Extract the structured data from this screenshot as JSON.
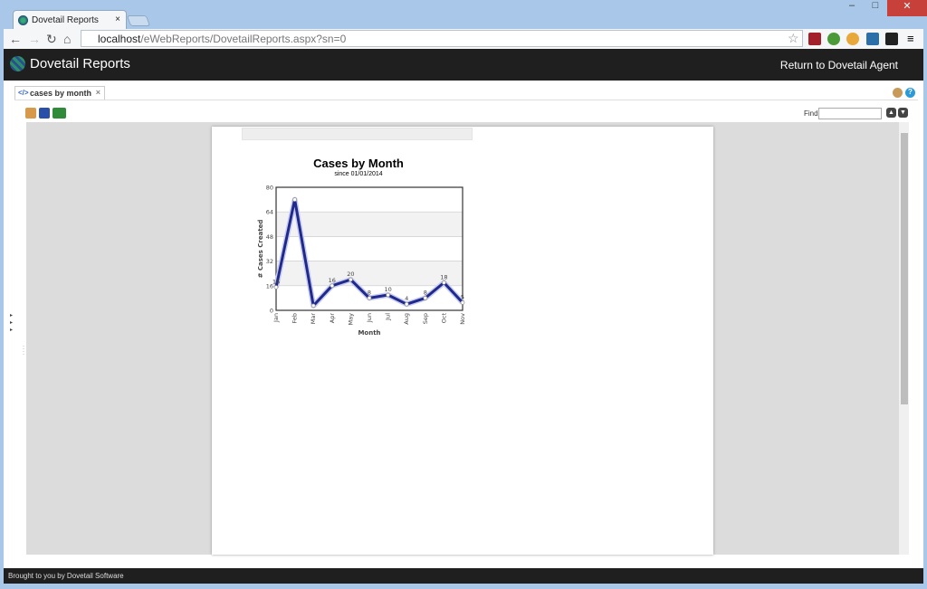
{
  "browser": {
    "tab_title": "Dovetail Reports",
    "url_host": "localhost",
    "url_path": "/eWebReports/DovetailReports.aspx?sn=0"
  },
  "app": {
    "title": "Dovetail Reports",
    "return_link": "Return to Dovetail Agent",
    "footer": "Brought to you by Dovetail Software"
  },
  "report": {
    "tab_label": "cases by month",
    "find_label": "Find",
    "find_value": ""
  },
  "colors": {
    "header_bg": "#1f1f1f",
    "line": "#1f2a8c",
    "close": "#c7403a"
  },
  "chart_data": {
    "type": "line",
    "title": "Cases by Month",
    "subtitle": "since 01/01/2014",
    "xlabel": "Month",
    "ylabel": "# Cases Created",
    "categories": [
      "Jan",
      "Feb",
      "Mar",
      "Apr",
      "May",
      "Jun",
      "Jul",
      "Aug",
      "Sep",
      "Oct",
      "Nov"
    ],
    "values": [
      15,
      72,
      3,
      16,
      20,
      8,
      10,
      4,
      8,
      18,
      5
    ],
    "data_labels": [
      "16",
      "",
      "",
      "16",
      "20",
      "8",
      "10",
      "4",
      "8",
      "18",
      "5"
    ],
    "ylim": [
      0,
      80
    ],
    "yticks": [
      "0",
      "16",
      "32",
      "48",
      "64",
      "80"
    ],
    "grid": true,
    "legend": "none"
  }
}
